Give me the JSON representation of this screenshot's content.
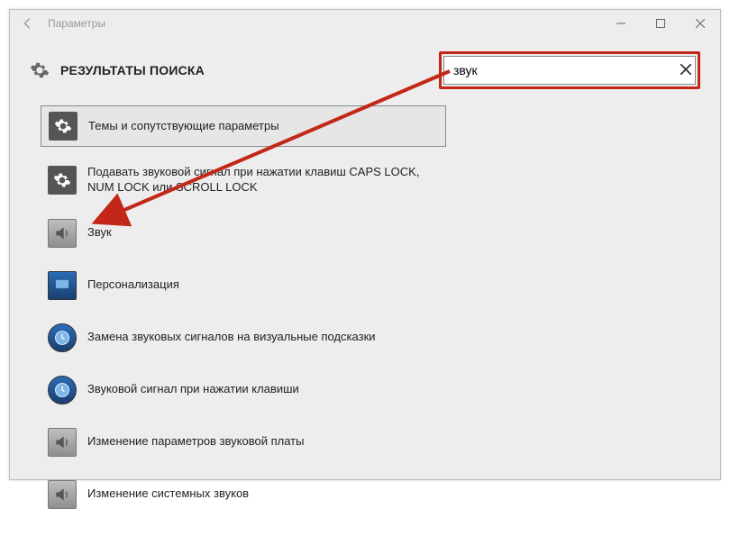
{
  "titlebar": {
    "title": "Параметры"
  },
  "header": {
    "title": "РЕЗУЛЬТАТЫ ПОИСКА"
  },
  "search": {
    "value": "звук"
  },
  "results": [
    {
      "label": "Темы и сопутствующие параметры",
      "icon": "gear",
      "selected": true
    },
    {
      "label": "Подавать звуковой сигнал при нажатии клавиш CAPS LOCK, NUM LOCK или SCROLL LOCK",
      "icon": "gear",
      "selected": false
    },
    {
      "label": "Звук",
      "icon": "speaker",
      "selected": false
    },
    {
      "label": "Персонализация",
      "icon": "monitor",
      "selected": false
    },
    {
      "label": "Замена звуковых сигналов на визуальные подсказки",
      "icon": "clock",
      "selected": false
    },
    {
      "label": "Звуковой сигнал при нажатии клавиши",
      "icon": "clock",
      "selected": false
    },
    {
      "label": "Изменение параметров звуковой платы",
      "icon": "speaker",
      "selected": false
    },
    {
      "label": "Изменение системных звуков",
      "icon": "speaker",
      "selected": false
    }
  ]
}
